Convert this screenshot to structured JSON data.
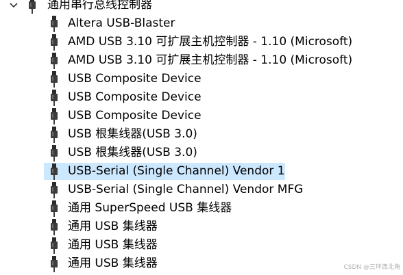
{
  "category": {
    "label": "通用串行总线控制器",
    "expanded": true,
    "icon": "usb-plug-icon"
  },
  "devices": [
    {
      "label": "Altera USB-Blaster",
      "icon": "usb-plug-icon"
    },
    {
      "label": "AMD USB 3.10 可扩展主机控制器 - 1.10 (Microsoft)",
      "icon": "usb-plug-icon"
    },
    {
      "label": "AMD USB 3.10 可扩展主机控制器 - 1.10 (Microsoft)",
      "icon": "usb-plug-icon"
    },
    {
      "label": "USB Composite Device",
      "icon": "usb-plug-icon"
    },
    {
      "label": "USB Composite Device",
      "icon": "usb-plug-icon"
    },
    {
      "label": "USB Composite Device",
      "icon": "usb-plug-icon"
    },
    {
      "label": "USB 根集线器(USB 3.0)",
      "icon": "usb-plug-icon"
    },
    {
      "label": "USB 根集线器(USB 3.0)",
      "icon": "usb-plug-icon"
    },
    {
      "label": "USB-Serial (Single Channel) Vendor 1",
      "icon": "usb-plug-icon",
      "selected": true
    },
    {
      "label": "USB-Serial (Single Channel) Vendor MFG",
      "icon": "usb-plug-icon"
    },
    {
      "label": "通用 SuperSpeed USB 集线器",
      "icon": "usb-plug-icon"
    },
    {
      "label": "通用 USB 集线器",
      "icon": "usb-plug-icon"
    },
    {
      "label": "通用 USB 集线器",
      "icon": "usb-plug-icon"
    },
    {
      "label": "通用 USB 集线器",
      "icon": "usb-plug-icon"
    }
  ],
  "watermark": "CSDN @三环西北角",
  "colors": {
    "selection": "#cce8ff",
    "icon_dark": "#2b2b2b",
    "icon_light": "#8a8a8a"
  }
}
